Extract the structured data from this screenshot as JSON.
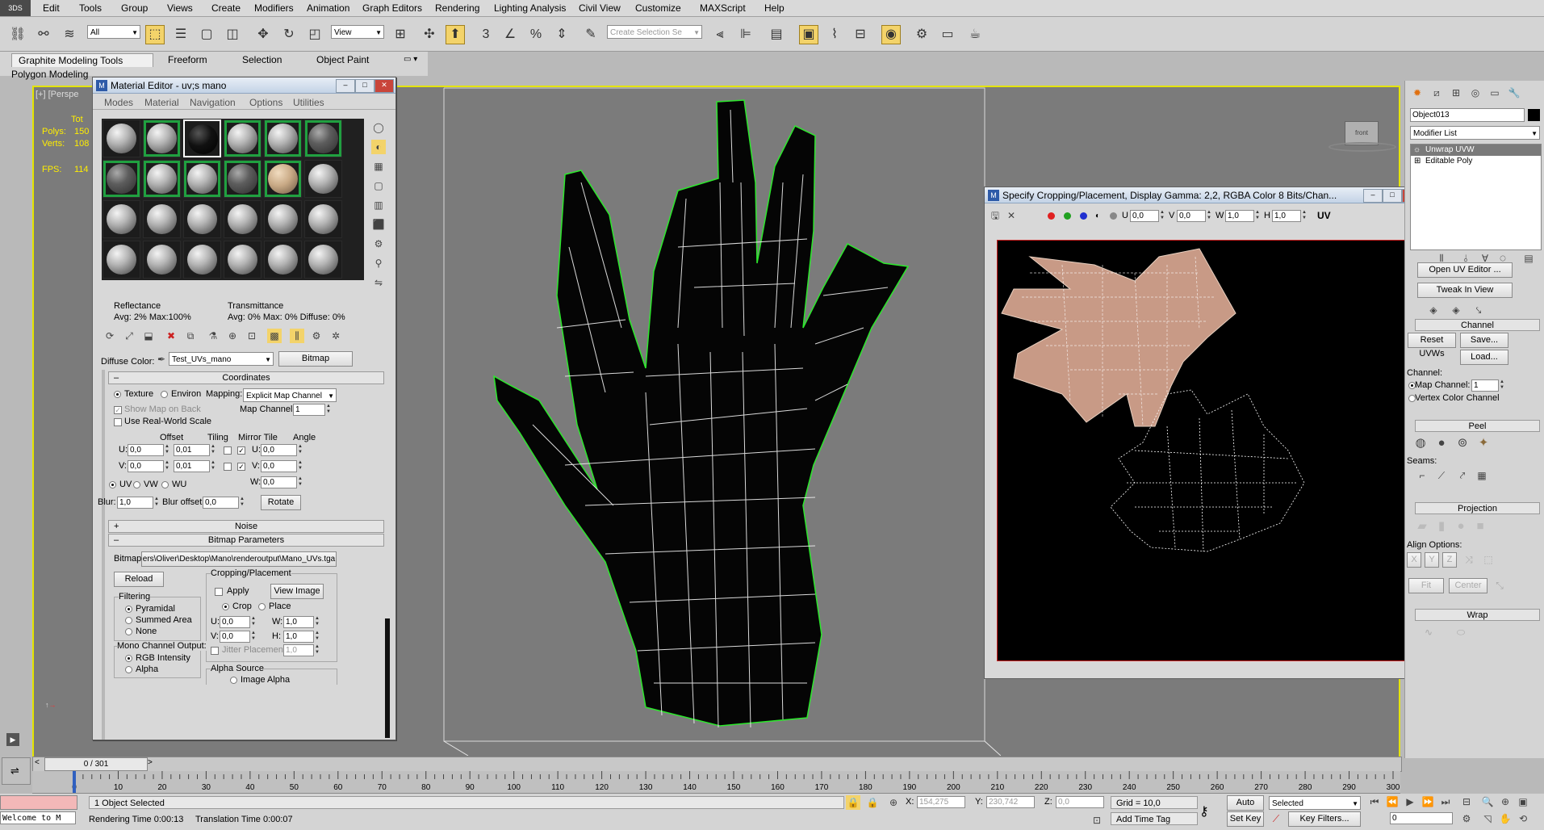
{
  "app": {
    "logo": "3DS"
  },
  "menu": [
    "Edit",
    "Tools",
    "Group",
    "Views",
    "Create",
    "Modifiers",
    "Animation",
    "Graph Editors",
    "Rendering",
    "Lighting Analysis",
    "Civil View",
    "Customize",
    "MAXScript",
    "Help"
  ],
  "toolbar": {
    "filter_value": "All",
    "refcoord_value": "View",
    "named_sel_placeholder": "Create Selection Se"
  },
  "ribbon": {
    "tabs": [
      "Graphite Modeling Tools",
      "Freeform",
      "Selection",
      "Object Paint"
    ],
    "sub_label": "Polygon Modeling"
  },
  "viewport": {
    "label": "[+] [Perspe",
    "stats": {
      "total": "Tot",
      "polys_label": "Polys:",
      "polys_value": "150",
      "verts_label": "Verts:",
      "verts_value": "108",
      "fps_label": "FPS:",
      "fps_value": "114"
    },
    "viewcube_label": "front"
  },
  "material_editor": {
    "title": "Material Editor - uv;s mano",
    "menu": [
      "Modes",
      "Material",
      "Navigation",
      "Options",
      "Utilities"
    ],
    "reflectance_label": "Reflectance",
    "reflectance_avg": "Avg:    2% Max:100%",
    "transmittance_label": "Transmittance",
    "transmittance_avg": "Avg:    0% Max:    0%  Diffuse:    0%",
    "diffuse_label": "Diffuse Color:",
    "material_name": "Test_UVs_mano",
    "material_type": "Bitmap",
    "coordinates": {
      "header": "Coordinates",
      "texture": "Texture",
      "environ": "Environ",
      "mapping_label": "Mapping:",
      "mapping_value": "Explicit Map Channel",
      "show_map": "Show Map on Back",
      "map_channel_label": "Map Channel:",
      "map_channel_value": "1",
      "real_world": "Use Real-World Scale",
      "col_offset": "Offset",
      "col_tiling": "Tiling",
      "col_mirror": "Mirror Tile",
      "col_angle": "Angle",
      "u_label": "U:",
      "v_label": "V:",
      "w_label": "W:",
      "u_offset": "0,0",
      "v_offset": "0,0",
      "u_tiling": "0,01",
      "v_tiling": "0,01",
      "u_angle": "0,0",
      "v_angle": "0,0",
      "w_angle": "0,0",
      "uv": "UV",
      "vw": "VW",
      "wu": "WU",
      "blur_label": "Blur:",
      "blur_value": "1,0",
      "blur_offset_label": "Blur offset:",
      "blur_offset_value": "0,0",
      "rotate": "Rotate"
    },
    "noise_header": "Noise",
    "bitmap_params": {
      "header": "Bitmap Parameters",
      "bitmap_label": "Bitmap:",
      "bitmap_path": "ers\\Oliver\\Desktop\\Mano\\renderoutput\\Mano_UVs.tga",
      "reload": "Reload",
      "cropping_label": "Cropping/Placement",
      "apply": "Apply",
      "view_image": "View Image",
      "crop": "Crop",
      "place": "Place",
      "u_label": "U:",
      "v_label": "V:",
      "w_label": "W:",
      "h_label": "H:",
      "u_value": "0,0",
      "v_value": "0,0",
      "w_value": "1,0",
      "h_value": "1,0",
      "jitter": "Jitter Placement:",
      "jitter_value": "1,0",
      "filtering_label": "Filtering",
      "pyramidal": "Pyramidal",
      "summed_area": "Summed Area",
      "none": "None",
      "mono_label": "Mono Channel Output:",
      "rgb_intensity": "RGB Intensity",
      "alpha": "Alpha",
      "alpha_source": "Alpha Source",
      "image_alpha": "Image Alpha"
    }
  },
  "crop_window": {
    "title": "Specify Cropping/Placement, Display Gamma: 2,2, RGBA Color 8 Bits/Chan...",
    "u_label": "U",
    "v_label": "V",
    "w_label": "W",
    "h_label": "H",
    "u_value": "0,0",
    "v_value": "0,0",
    "w_value": "1,0",
    "h_value": "1,0",
    "uv_label": "UV"
  },
  "command_panel": {
    "object_name": "Object013",
    "modifier_list": "Modifier List",
    "stack": [
      "Unwrap UVW",
      "Editable Poly"
    ],
    "open_uv_editor": "Open UV Editor ...",
    "tweak_in_view": "Tweak In View",
    "channel_header": "Channel",
    "reset_uvws": "Reset UVWs",
    "save": "Save...",
    "load": "Load...",
    "channel_label": "Channel:",
    "map_channel_label": "Map Channel:",
    "map_channel_value": "1",
    "vertex_color_channel": "Vertex Color Channel",
    "peel_header": "Peel",
    "seams_label": "Seams:",
    "projection_header": "Projection",
    "align_options": "Align Options:",
    "axes": [
      "X",
      "Y",
      "Z"
    ],
    "fit": "Fit",
    "center": "Center",
    "wrap_header": "Wrap"
  },
  "timeline": {
    "frame_display": "0 / 301",
    "ticks": [
      "0",
      "10",
      "20",
      "30",
      "40",
      "50",
      "60",
      "70",
      "80",
      "90",
      "100",
      "110",
      "120",
      "130",
      "140",
      "150",
      "160",
      "170",
      "180",
      "190",
      "200",
      "210",
      "220",
      "230",
      "240",
      "250",
      "260",
      "270",
      "280",
      "290",
      "300"
    ]
  },
  "status": {
    "selected": "1 Object Selected",
    "render_time": "Rendering Time  0:00:13",
    "translation_time": "Translation Time  0:00:07",
    "welcome": "Welcome to M",
    "x_label": "X:",
    "x_value": "154,275",
    "y_label": "Y:",
    "y_value": "230,742",
    "z_label": "Z:",
    "z_value": "0,0",
    "grid": "Grid = 10,0",
    "add_time_tag": "Add Time Tag",
    "auto_key": "Auto Key",
    "set_key": "Set Key",
    "key_mode_value": "Selected",
    "key_filters": "Key Filters...",
    "current_frame": "0"
  }
}
